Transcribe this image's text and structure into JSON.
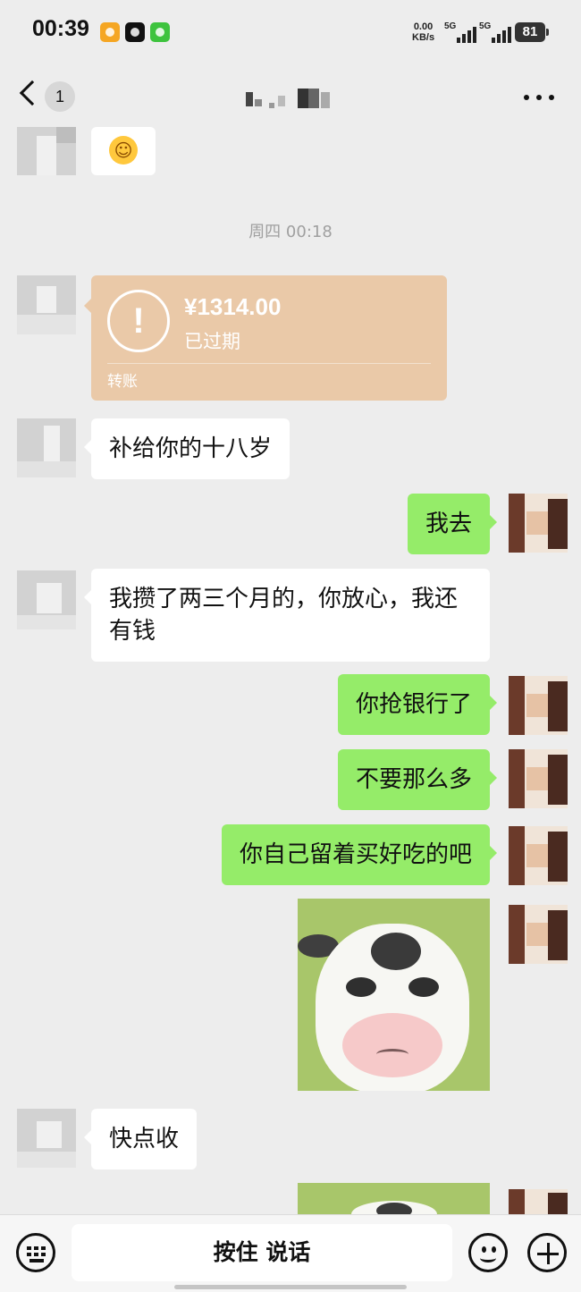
{
  "status_bar": {
    "time": "00:39",
    "net_speed_value": "0.00",
    "net_speed_unit": "KB/s",
    "signal_1": "5G",
    "signal_2": "5G",
    "battery": "81"
  },
  "header": {
    "back_count": "1",
    "more_icon": "more-icon"
  },
  "timestamp": "周四 00:18",
  "transfer": {
    "amount": "¥1314.00",
    "status": "已过期",
    "label": "转账",
    "icon": "exclamation-icon"
  },
  "messages": {
    "m1": "补给你的十八岁",
    "m2": "我去",
    "m3": "我攒了两三个月的，你放心，我还有钱",
    "m4": "你抢银行了",
    "m5": "不要那么多",
    "m6": "你自己留着买好吃的吧",
    "m7": "快点收"
  },
  "input_bar": {
    "voice_label": "按住 说话"
  },
  "colors": {
    "background": "#ededed",
    "outgoing_bubble": "#95ec69",
    "incoming_bubble": "#ffffff",
    "transfer_card": "#eac9a8"
  }
}
